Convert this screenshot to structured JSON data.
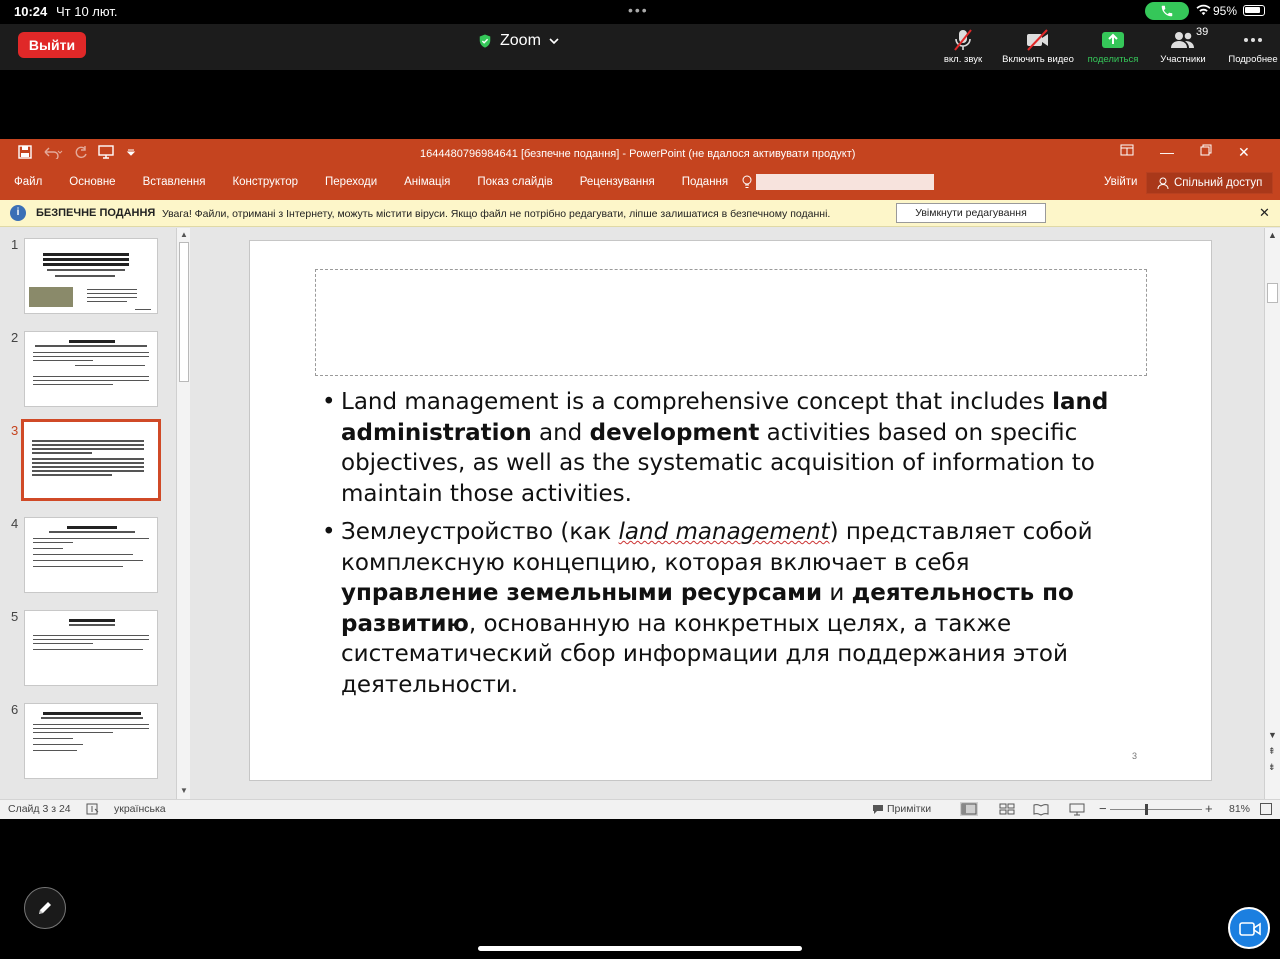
{
  "status_bar": {
    "time": "10:24",
    "date": "Чт 10 лют.",
    "battery": "95%"
  },
  "zoom": {
    "leave_label": "Выйти",
    "title": "Zoom",
    "participants_count": "39",
    "controls": [
      {
        "label": "вкл. звук",
        "icon": "mic-muted-icon"
      },
      {
        "label": "Включить видео",
        "icon": "video-off-icon"
      },
      {
        "label": "поделиться",
        "icon": "share-screen-icon"
      },
      {
        "label": "Участники",
        "icon": "participants-icon"
      },
      {
        "label": "Подробнее",
        "icon": "more-icon"
      }
    ]
  },
  "ppt": {
    "window_title": "1644480796984641 [безпечне подання] - PowerPoint (не вдалося активувати продукт)",
    "ribbon_tabs": [
      "Файл",
      "Основне",
      "Вставлення",
      "Конструктор",
      "Переходи",
      "Анімація",
      "Показ слайдів",
      "Рецензування",
      "Подання"
    ],
    "sign_in": "Увійти",
    "share": "Спільний доступ",
    "message_bar": {
      "label": "БЕЗПЕЧНЕ ПОДАННЯ",
      "message": "Увага! Файли, отримані з Інтернету, можуть містити віруси. Якщо файл не потрібно редагувати, ліпше залишатися в безпечному поданні.",
      "button": "Увімкнути редагування"
    },
    "thumbnails": [
      "1",
      "2",
      "3",
      "4",
      "5",
      "6"
    ],
    "active_slide": 3,
    "slide": {
      "bullet1": {
        "t1": "Land management is a comprehensive concept that includes ",
        "b1": "land administration",
        "t2": " and ",
        "b2": "development",
        "t3": " activities based on specific objectives, as well as the systematic acquisition of information to maintain those activities."
      },
      "bullet2": {
        "t1": "Землеустройство (как ",
        "i1": "land management",
        "t2": ") представляет собой комплексную концепцию, которая включает в себя ",
        "b1": "управление земельными ресурсами",
        "t3": " и ",
        "b2": "деятельность по развитию",
        "t4": ", основанную на конкретных целях, а также систематический сбор информации для поддержания этой деятельности."
      },
      "page_number": "3"
    },
    "statusbar": {
      "slide_of": "Слайд 3 з 24",
      "language": "українська",
      "notes": "Примітки",
      "zoom": "81%"
    }
  }
}
